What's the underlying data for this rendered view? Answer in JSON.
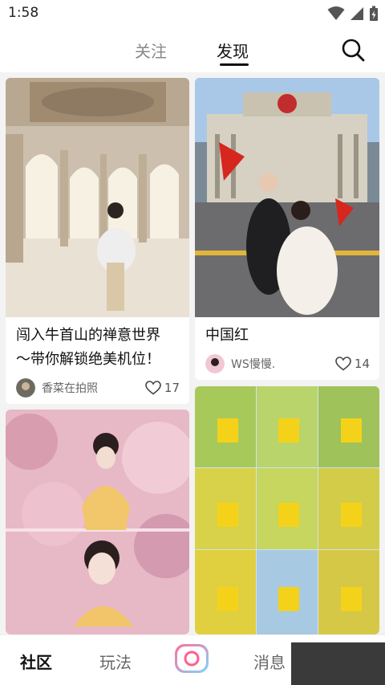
{
  "status_bar": {
    "time": "1:58"
  },
  "top_tabs": [
    {
      "label": "关注",
      "active": false
    },
    {
      "label": "发现",
      "active": true
    }
  ],
  "feed": [
    {
      "title_line1": "闯入牛首山的禅意世界",
      "title_line2": "～带你解锁绝美机位！",
      "author": "香菜在拍照",
      "likes": "17"
    },
    {
      "title_line1": "中国红",
      "author": "WS慢慢.",
      "likes": "14"
    },
    {
      "title_line1": "",
      "author": "",
      "likes": ""
    },
    {
      "title_line1": "",
      "author": "",
      "likes": ""
    }
  ],
  "bottom_nav": [
    {
      "label": "社区",
      "active": true
    },
    {
      "label": "玩法",
      "active": false
    },
    {
      "label": "",
      "icon": "camera-icon"
    },
    {
      "label": "消息",
      "active": false
    }
  ],
  "colors": {
    "accent_pink": "#ff5f8f",
    "camera_gradient_start": "#ff6f9c",
    "camera_gradient_end": "#7fd6ff",
    "text_primary": "#111111",
    "text_secondary": "#888888"
  }
}
